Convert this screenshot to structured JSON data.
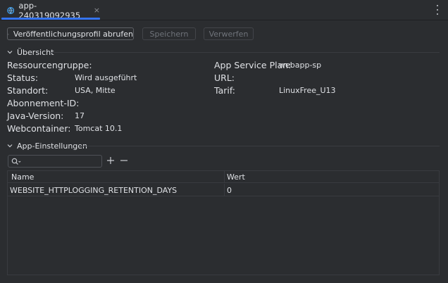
{
  "tab": {
    "title": "app-240319092935",
    "close_glyph": "×"
  },
  "toolbar": {
    "fetch_profile_label": "Veröffentlichungsprofil abrufen",
    "save_label": "Speichern",
    "discard_label": "Verwerfen"
  },
  "overview": {
    "header": "Übersicht",
    "resource_group_label": "Ressourcengruppe:",
    "status_label": "Status:",
    "status_value": "Wird ausgeführt",
    "location_label": "Standort:",
    "location_value": "USA, Mitte",
    "subscription_label": "Abonnement-ID:",
    "java_label": "Java-Version:",
    "java_value": "17",
    "webcontainer_label": "Webcontainer:",
    "webcontainer_value": "Tomcat 10.1",
    "plan_label": "App Service Plan:",
    "plan_value": "webapp-sp",
    "url_label": "URL:",
    "tier_label": "Tarif:",
    "tier_value": "LinuxFree_U13"
  },
  "settings": {
    "header": "App-Einstellungen",
    "columns": {
      "name": "Name",
      "value": "Wert"
    },
    "rows": [
      {
        "name": "WEBSITE_HTTPLOGGING_RETENTION_DAYS",
        "value": "0"
      }
    ]
  },
  "icons": {
    "tab": "azure-webapp-icon",
    "more": "more-vertical-icon",
    "download": "download-icon",
    "chevron": "chevron-down-icon",
    "search": "search-icon",
    "add": "plus-icon",
    "remove": "minus-icon"
  },
  "colors": {
    "accent": "#3574f0",
    "background": "#2b2d30",
    "text": "#dfe1e5"
  }
}
